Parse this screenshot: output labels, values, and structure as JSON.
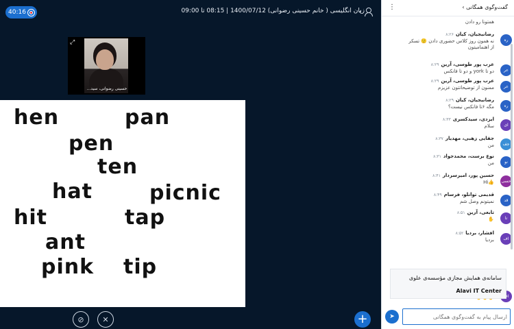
{
  "topbar": {
    "timer": "40:16",
    "meeting_title": "زبان انگلیسی ( خانم حسینی رضوانی) 1400/07/12 | 08:15 تا 09:00"
  },
  "webcam": {
    "label": "حسینی رضوانی، سید..."
  },
  "slide": {
    "words": [
      "hen",
      "pan",
      "pen",
      "ten",
      "hat",
      "picnic",
      "hit",
      "tap",
      "ant",
      "pink",
      "tip"
    ]
  },
  "chat": {
    "title": "گفت‌وگوی همگانی",
    "input_placeholder": "ارسال پیام به گفت‌وگوی همگانی",
    "top_partial": "همتونا رو دادن",
    "messages": [
      {
        "initials": "ره",
        "name": "رضانیجیان، کیان",
        "time": "۸:۲۶",
        "text": [
          "نه همون روز کلاس حضوری دادن 🙂 تسکر",
          "از اهتمامیتون"
        ],
        "color": "#2a63c6"
      },
      {
        "initials": "عر",
        "name": "عرب پور طوسی، آرین",
        "time": "۸:۲۹",
        "text": [
          "دو تا york و دو تا فانکس"
        ],
        "color": "#2a63c6"
      },
      {
        "initials": "عر",
        "name": "عرب پور طوسی، آرین",
        "time": "۸:۲۹",
        "text": [
          "ممنون از توضیحاتتون عزیزم"
        ],
        "color": "#2a63c6"
      },
      {
        "initials": "ره",
        "name": "رضانیجیان، کیان",
        "time": "۸:۲۹",
        "text": [
          "مگه ۶تا فانکس نیست؟"
        ],
        "color": "#2a63c6"
      },
      {
        "initials": "ای",
        "name": "ایزدی، سیدکسری",
        "time": "۸:۳۳",
        "text": [
          "سلام"
        ],
        "color": "#6a3fb8"
      },
      {
        "initials": "جف",
        "name": "جفایی زهبی، مهدیار",
        "time": "۸:۳۷",
        "text": [
          "من"
        ],
        "color": "#3a8fd6"
      },
      {
        "initials": "نو",
        "name": "نوع برست، محمدجواد",
        "time": "۸:۳۱",
        "text": [
          "من"
        ],
        "color": "#2a63c6"
      },
      {
        "initials": "حسی",
        "name": "حسین پور، امیرسردار",
        "time": "۸:۴۱",
        "text": [
          "👍Hi"
        ],
        "color": "#8e2f9e"
      },
      {
        "initials": "قد",
        "name": "قدیمی توانلو، فرسام",
        "time": "۸:۴۹",
        "text": [
          "نمیتونم وصل شم"
        ],
        "color": "#2a63c6"
      },
      {
        "initials": "تا",
        "name": "تابعی، آرین",
        "time": "۸:۵۱",
        "text": [
          "✋"
        ],
        "color": "#6a3fb8"
      },
      {
        "initials": "اف",
        "name": "افشار، بردیا",
        "time": "۸:۵۲",
        "text": [
          "بردیا"
        ],
        "color": "#6a3fb8"
      },
      {
        "initials": "اف",
        "name": "افشار، بردیا",
        "time": "۸:۵۲",
        "text": [
          "✋✋✋"
        ],
        "color": "#6a3fb8"
      }
    ],
    "pinned": {
      "line1": "سامانه‌ی همایش مجازی مؤسسه‌ی علوی",
      "line2": "Alavi IT Center"
    }
  }
}
